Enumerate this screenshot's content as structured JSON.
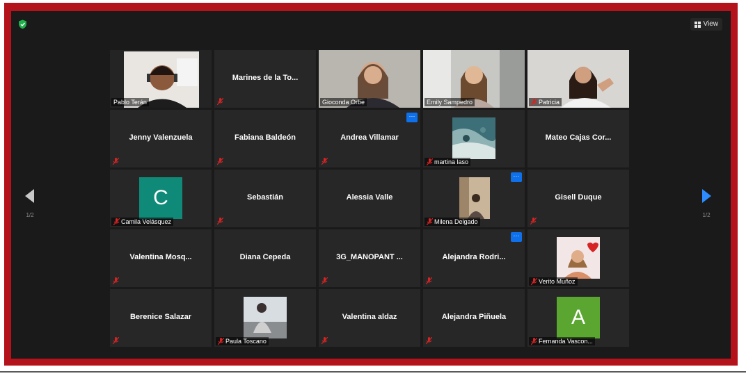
{
  "view_label": "View",
  "nav": {
    "left_page": "1/2",
    "right_page": "1/2"
  },
  "tiles": [
    {
      "name": "Pablo Terán"
    },
    {
      "name": "Marines de la To..."
    },
    {
      "name": "Gioconda Orbe"
    },
    {
      "name": "Emily Sampedro"
    },
    {
      "name": "Patricia"
    },
    {
      "name": "Jenny Valenzuela"
    },
    {
      "name": "Fabiana Baldeón"
    },
    {
      "name": "Andrea Villamar"
    },
    {
      "name": "martina laso"
    },
    {
      "name": "Mateo Cajas Cor..."
    },
    {
      "name": "Camila Velásquez",
      "initial": "C"
    },
    {
      "name": "Sebastián"
    },
    {
      "name": "Alessia Valle"
    },
    {
      "name": "Milena Delgado"
    },
    {
      "name": "Gisell Duque"
    },
    {
      "name": "Valentina  Mosq..."
    },
    {
      "name": "Diana Cepeda"
    },
    {
      "name": "3G_MANOPANT ..."
    },
    {
      "name": "Alejandra  Rodri..."
    },
    {
      "name": "Verito Muñoz"
    },
    {
      "name": "Berenice Salazar"
    },
    {
      "name": "Paula Toscano"
    },
    {
      "name": "Valentina aldaz"
    },
    {
      "name": "Alejandra Piñuela"
    },
    {
      "name": "Fernanda Vascon...",
      "initial": "A"
    }
  ],
  "colors": {
    "frame": "#b5131b",
    "active": "#d8e020",
    "accent": "#0e71eb",
    "avatar_c": "#0f8a78",
    "avatar_a": "#5aa630"
  }
}
